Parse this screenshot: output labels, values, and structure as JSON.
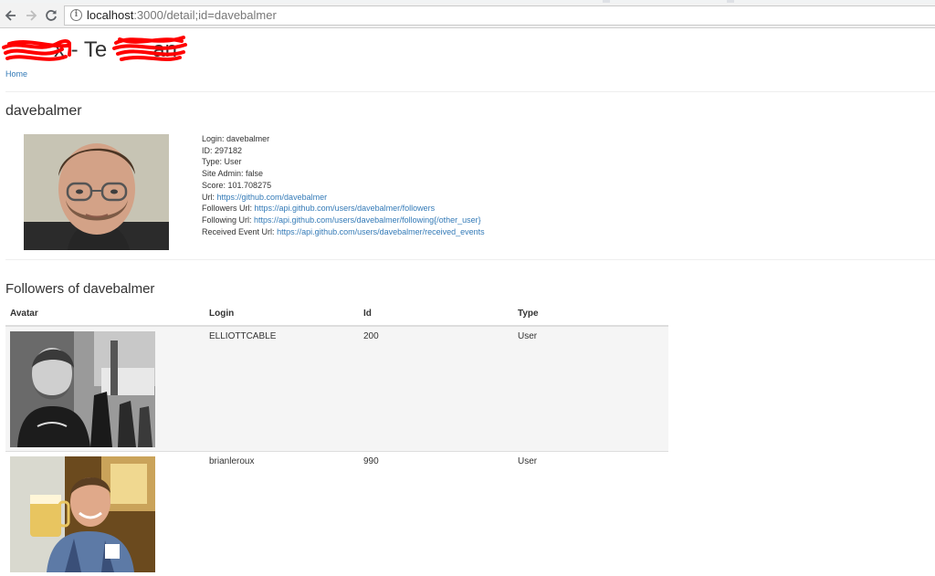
{
  "browser": {
    "url_host": "localhost",
    "url_path": ":3000/detail;id=davebalmer",
    "back_icon": "arrow-left-icon",
    "forward_icon": "arrow-right-icon",
    "reload_icon": "reload-icon",
    "info_icon": "info-icon"
  },
  "site": {
    "brand_visible_fragment_1": "x - Te",
    "brand_visible_fragment_2": "an",
    "home_link": "Home"
  },
  "user": {
    "title": "davebalmer",
    "details": [
      {
        "label": "Login:",
        "value": "davebalmer",
        "is_link": false
      },
      {
        "label": "ID:",
        "value": "297182",
        "is_link": false
      },
      {
        "label": "Type:",
        "value": "User",
        "is_link": false
      },
      {
        "label": "Site Admin:",
        "value": "false",
        "is_link": false
      },
      {
        "label": "Score:",
        "value": "101.708275",
        "is_link": false
      },
      {
        "label": "Url:",
        "value": "https://github.com/davebalmer",
        "is_link": true
      },
      {
        "label": "Followers Url:",
        "value": "https://api.github.com/users/davebalmer/followers",
        "is_link": true
      },
      {
        "label": "Following Url:",
        "value": "https://api.github.com/users/davebalmer/following{/other_user}",
        "is_link": true
      },
      {
        "label": "Received Event Url:",
        "value": "https://api.github.com/users/davebalmer/received_events",
        "is_link": true
      }
    ]
  },
  "followers": {
    "title": "Followers of davebalmer",
    "columns": [
      "Avatar",
      "Login",
      "Id",
      "Type"
    ],
    "rows": [
      {
        "login": "ELLIOTTCABLE",
        "id": "200",
        "type": "User"
      },
      {
        "login": "brianleroux",
        "id": "990",
        "type": "User"
      }
    ]
  },
  "colors": {
    "link": "#337ab7",
    "redaction": "#ff0000",
    "row_stripe": "#f5f5f5"
  }
}
